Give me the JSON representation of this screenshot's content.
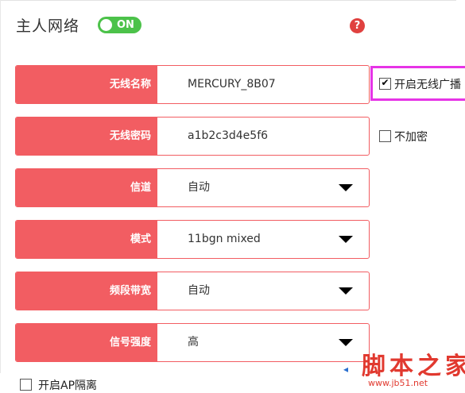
{
  "header": {
    "title": "主人网络",
    "toggle_label": "ON",
    "help_icon": "?"
  },
  "fields": [
    {
      "label": "无线名称",
      "value": "MERCURY_8B07",
      "dropdown": false
    },
    {
      "label": "无线密码",
      "value": "a1b2c3d4e5f6",
      "dropdown": false
    },
    {
      "label": "信道",
      "value": "自动",
      "dropdown": true
    },
    {
      "label": "模式",
      "value": "11bgn mixed",
      "dropdown": true
    },
    {
      "label": "频段带宽",
      "value": "自动",
      "dropdown": true
    },
    {
      "label": "信号强度",
      "value": "高",
      "dropdown": true
    }
  ],
  "checkboxes": {
    "broadcast": {
      "label": "开启无线广播",
      "checked": true
    },
    "no_encrypt": {
      "label": "不加密",
      "checked": false
    },
    "ap_isolation": {
      "label": "开启AP隔离",
      "checked": false
    }
  },
  "watermark": {
    "main": "脚本之家",
    "sub": "www.jb51.net"
  },
  "colors": {
    "accent": "#f25d62",
    "toggle_on": "#4cc24a",
    "help": "#e0413f",
    "highlight": "#e634e6",
    "watermark": "#e1392f"
  }
}
